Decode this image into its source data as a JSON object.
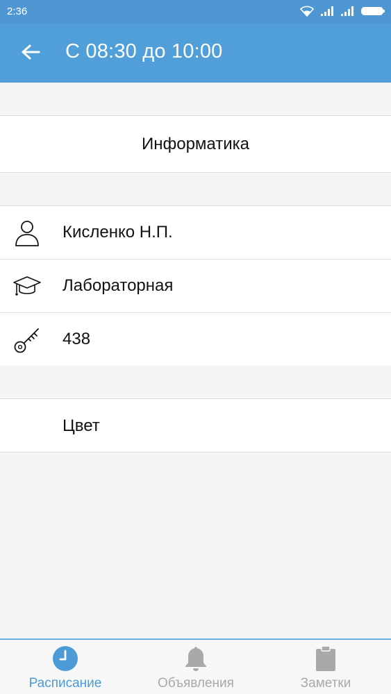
{
  "status_bar": {
    "time": "2:36"
  },
  "app_bar": {
    "title": "С 08:30 до 10:00"
  },
  "subject": "Информатика",
  "details": [
    {
      "icon": "person-icon",
      "text": "Кисленко Н.П."
    },
    {
      "icon": "graduation-cap-icon",
      "text": "Лабораторная"
    },
    {
      "icon": "key-icon",
      "text": "438"
    }
  ],
  "color_row": {
    "label": "Цвет"
  },
  "bottom_nav": [
    {
      "label": "Расписание",
      "icon": "clock-icon",
      "active": true
    },
    {
      "label": "Объявления",
      "icon": "bell-icon",
      "active": false
    },
    {
      "label": "Заметки",
      "icon": "clipboard-icon",
      "active": false
    }
  ],
  "colors": {
    "accent": "#519fd8",
    "active_tab": "#4c9bd6",
    "inactive_tab": "#a9a9a9"
  }
}
